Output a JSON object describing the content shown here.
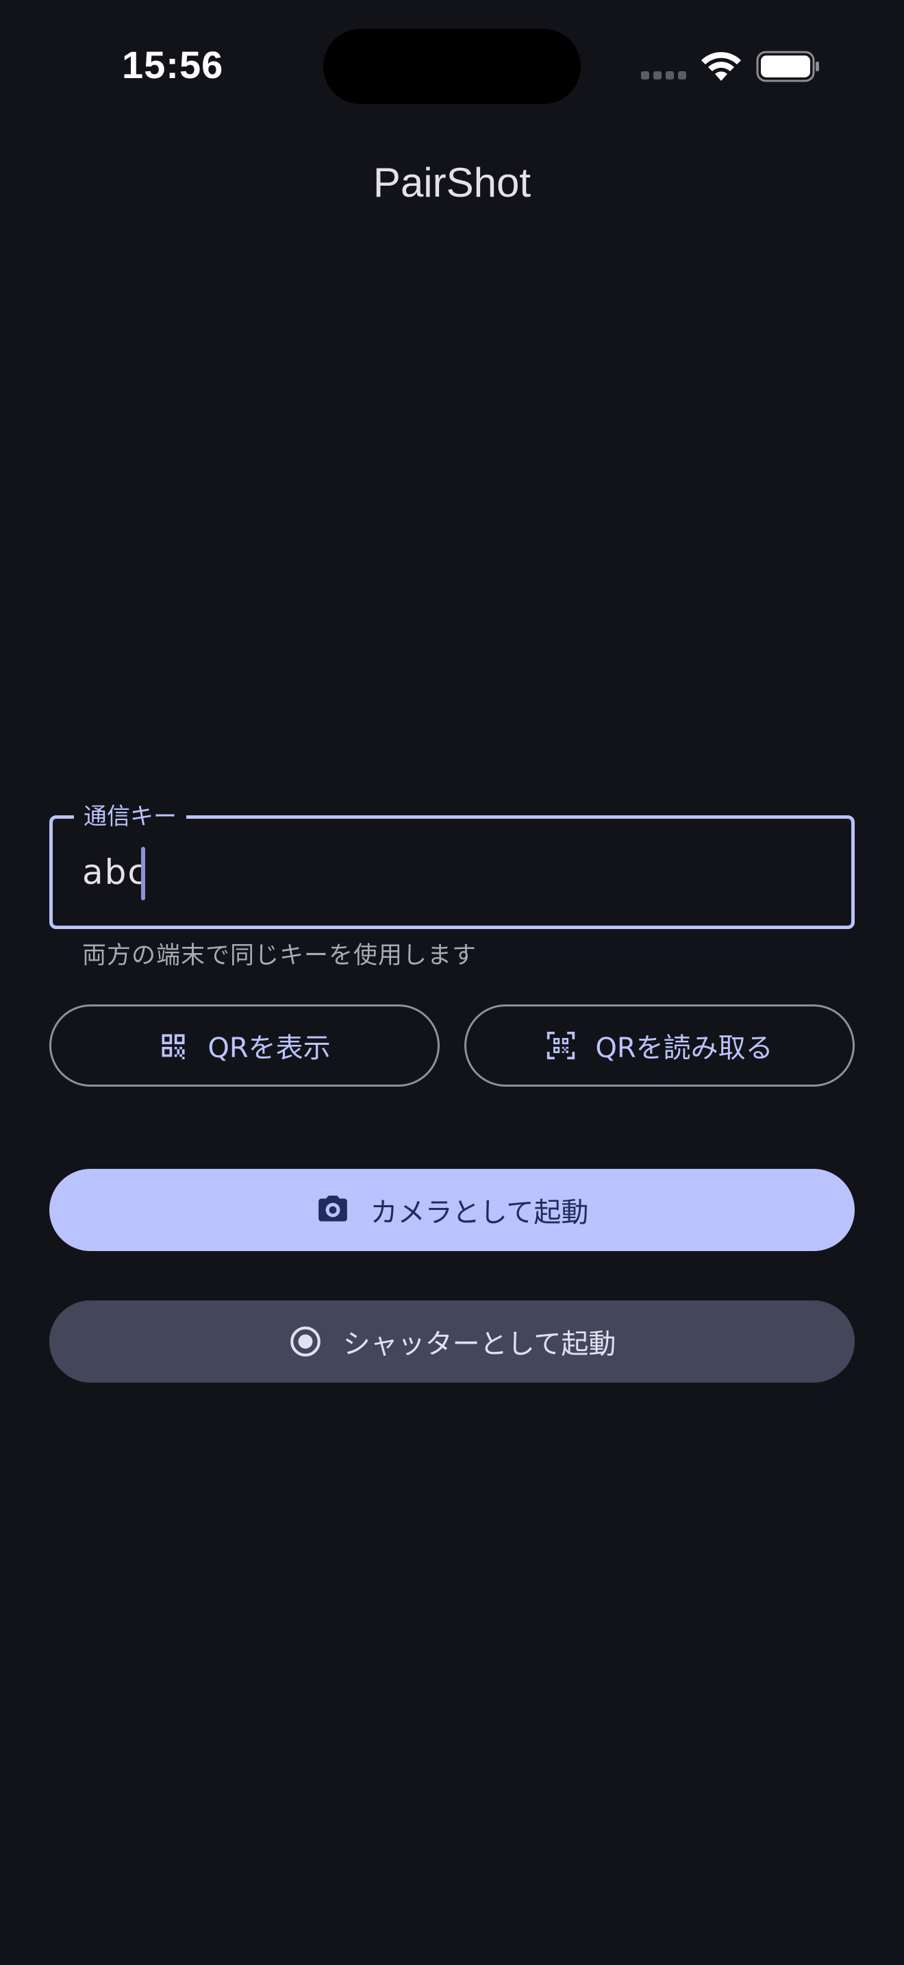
{
  "status_bar": {
    "time": "15:56",
    "icons": [
      "cellular-signal-icon",
      "wifi-icon",
      "battery-icon"
    ]
  },
  "app": {
    "title": "PairShot"
  },
  "key_field": {
    "label": "通信キー",
    "value": "abc",
    "helper": "両方の端末で同じキーを使用します"
  },
  "buttons": {
    "show_qr": {
      "label": "QRを表示",
      "icon": "qr-code-icon"
    },
    "scan_qr": {
      "label": "QRを読み取る",
      "icon": "qr-scan-icon"
    },
    "start_camera": {
      "label": "カメラとして起動",
      "icon": "camera-icon"
    },
    "start_shutter": {
      "label": "シャッターとして起動",
      "icon": "radio-button-icon"
    }
  },
  "colors": {
    "background": "#121318",
    "primary": "#bbc3ff",
    "on_primary": "#232b5e",
    "secondary_container": "#444659",
    "outline": "#8f909a"
  }
}
